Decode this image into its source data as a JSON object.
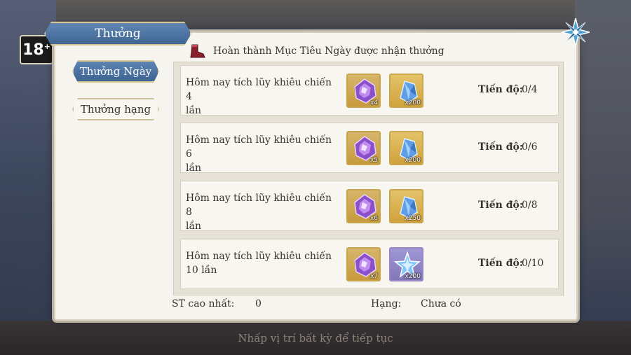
{
  "window": {
    "title": "Thưởng"
  },
  "age_rating": {
    "value": "18",
    "plus": "+"
  },
  "sidebar": {
    "items": [
      {
        "label": "Thưởng Ngày",
        "active": true
      },
      {
        "label": "Thưởng hạng",
        "active": false
      }
    ]
  },
  "header": {
    "text": "Hoàn thành Mục Tiêu Ngày được nhận thưởng"
  },
  "tasks": [
    {
      "line1": "Hôm nay tích lũy khiêu chiến 4",
      "line2": "lần",
      "rewards": [
        {
          "icon": "purple-crystal-icon",
          "qty": "x4"
        },
        {
          "icon": "blue-crystal-icon",
          "qty": "x200"
        }
      ],
      "progress_label": "Tiến độ:",
      "progress": "0/4"
    },
    {
      "line1": "Hôm nay tích lũy khiêu chiến 6",
      "line2": "lần",
      "rewards": [
        {
          "icon": "purple-crystal-icon",
          "qty": "x5"
        },
        {
          "icon": "blue-crystal-icon",
          "qty": "x200"
        }
      ],
      "progress_label": "Tiến độ:",
      "progress": "0/6"
    },
    {
      "line1": "Hôm nay tích lũy khiêu chiến 8",
      "line2": "lần",
      "rewards": [
        {
          "icon": "purple-crystal-icon",
          "qty": "x6"
        },
        {
          "icon": "blue-crystal-icon",
          "qty": "x250"
        }
      ],
      "progress_label": "Tiến độ:",
      "progress": "0/8"
    },
    {
      "line1": "Hôm nay tích lũy khiêu chiến",
      "line2": "10 lần",
      "rewards": [
        {
          "icon": "purple-crystal-icon",
          "qty": "x7"
        },
        {
          "icon": "blue-star-icon",
          "qty": "x200"
        }
      ],
      "progress_label": "Tiến độ:",
      "progress": "0/10"
    }
  ],
  "footer": {
    "best_label": "ST cao nhất:",
    "best_value": "0",
    "rank_label": "Hạng:",
    "rank_value": "Chưa có"
  },
  "hint": "Nhấp vị trí bất kỳ để tiếp tục",
  "colors": {
    "banner_blue": "#4a71a0",
    "panel_bg": "#f6f4ef",
    "gold_border": "#c9a64c"
  }
}
